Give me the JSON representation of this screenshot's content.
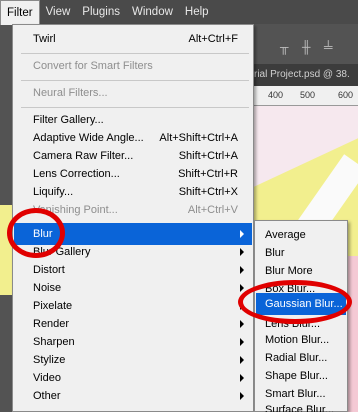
{
  "menubar": {
    "items": [
      {
        "label": "Filter",
        "active": true
      },
      {
        "label": "View"
      },
      {
        "label": "Plugins"
      },
      {
        "label": "Window"
      },
      {
        "label": "Help"
      }
    ]
  },
  "background": {
    "document_tab": "rial Project.psd @ 38.",
    "ruler_ticks": [
      "400",
      "500",
      "600"
    ]
  },
  "filter_menu": {
    "items": [
      {
        "label": "Twirl",
        "shortcut": "Alt+Ctrl+F"
      },
      {
        "label": "Convert for Smart Filters",
        "disabled": true
      },
      {
        "label": "Neural Filters...",
        "disabled": true
      },
      {
        "label": "Filter Gallery..."
      },
      {
        "label": "Adaptive Wide Angle...",
        "shortcut": "Alt+Shift+Ctrl+A"
      },
      {
        "label": "Camera Raw Filter...",
        "shortcut": "Shift+Ctrl+A"
      },
      {
        "label": "Lens Correction...",
        "shortcut": "Shift+Ctrl+R"
      },
      {
        "label": "Liquify...",
        "shortcut": "Shift+Ctrl+X"
      },
      {
        "label": "Vanishing Point...",
        "shortcut": "Alt+Ctrl+V"
      },
      {
        "label": "Blur",
        "submenu": true,
        "highlighted": true
      },
      {
        "label": "Blur Gallery",
        "submenu": true
      },
      {
        "label": "Distort",
        "submenu": true
      },
      {
        "label": "Noise",
        "submenu": true
      },
      {
        "label": "Pixelate",
        "submenu": true
      },
      {
        "label": "Render",
        "submenu": true
      },
      {
        "label": "Sharpen",
        "submenu": true
      },
      {
        "label": "Stylize",
        "submenu": true
      },
      {
        "label": "Video",
        "submenu": true
      },
      {
        "label": "Other",
        "submenu": true
      }
    ]
  },
  "blur_submenu": {
    "items": [
      {
        "label": "Average"
      },
      {
        "label": "Blur"
      },
      {
        "label": "Blur More"
      },
      {
        "label": "Box Blur..."
      },
      {
        "label": "Gaussian Blur...",
        "highlighted": true
      },
      {
        "label": "Lens Blur..."
      },
      {
        "label": "Motion Blur..."
      },
      {
        "label": "Radial Blur..."
      },
      {
        "label": "Shape Blur..."
      },
      {
        "label": "Smart Blur..."
      },
      {
        "label": "Surface Blur..."
      }
    ]
  },
  "colors": {
    "highlight": "#0a64d8",
    "annotation": "#e00000",
    "menubar_bg": "#4a4a4a"
  }
}
